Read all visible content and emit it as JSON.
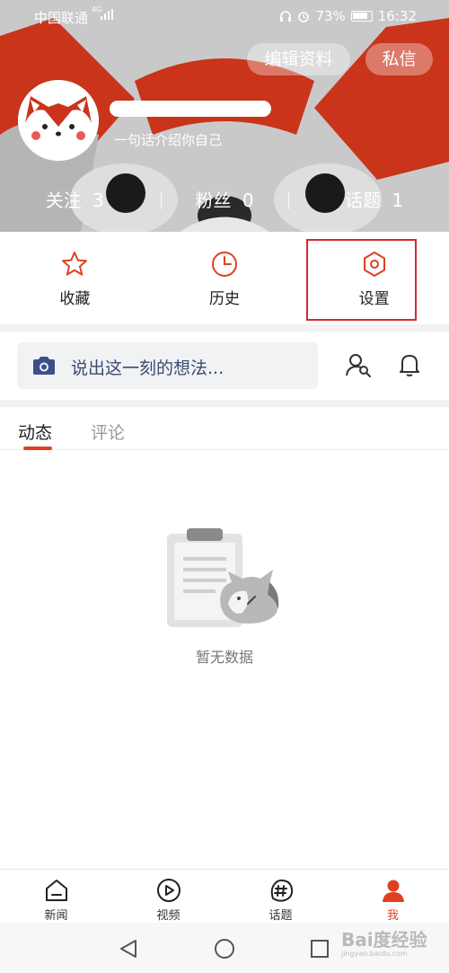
{
  "status_bar": {
    "carrier": "中国联通",
    "network": "4G",
    "battery": "73%",
    "time": "16:32"
  },
  "header": {
    "edit_profile_label": "编辑资料",
    "message_label": "私信",
    "bio": "一句话介绍你自己",
    "stats": [
      {
        "label": "关注",
        "value": "3"
      },
      {
        "label": "粉丝",
        "value": "0"
      },
      {
        "label": "话题",
        "value": "1"
      }
    ]
  },
  "quick_actions": [
    {
      "label": "收藏",
      "icon": "star-icon"
    },
    {
      "label": "历史",
      "icon": "clock-icon"
    },
    {
      "label": "设置",
      "icon": "settings-hexagon-icon"
    }
  ],
  "composer": {
    "placeholder": "说出这一刻的想法..."
  },
  "tabs": [
    {
      "label": "动态",
      "active": true
    },
    {
      "label": "评论",
      "active": false
    }
  ],
  "empty_state": {
    "text": "暂无数据"
  },
  "bottom_nav": [
    {
      "label": "新闻",
      "icon": "news-home-icon",
      "active": false
    },
    {
      "label": "视频",
      "icon": "video-play-icon",
      "active": false
    },
    {
      "label": "话题",
      "icon": "hashtag-icon",
      "active": false
    },
    {
      "label": "我",
      "icon": "person-icon",
      "active": true
    }
  ],
  "watermark": {
    "brand": "Bai度经验",
    "url": "jingyan.baidu.com"
  },
  "colors": {
    "accent": "#e0401f",
    "highlight_box": "#d42a2a",
    "fox_orange": "#c9341a"
  }
}
